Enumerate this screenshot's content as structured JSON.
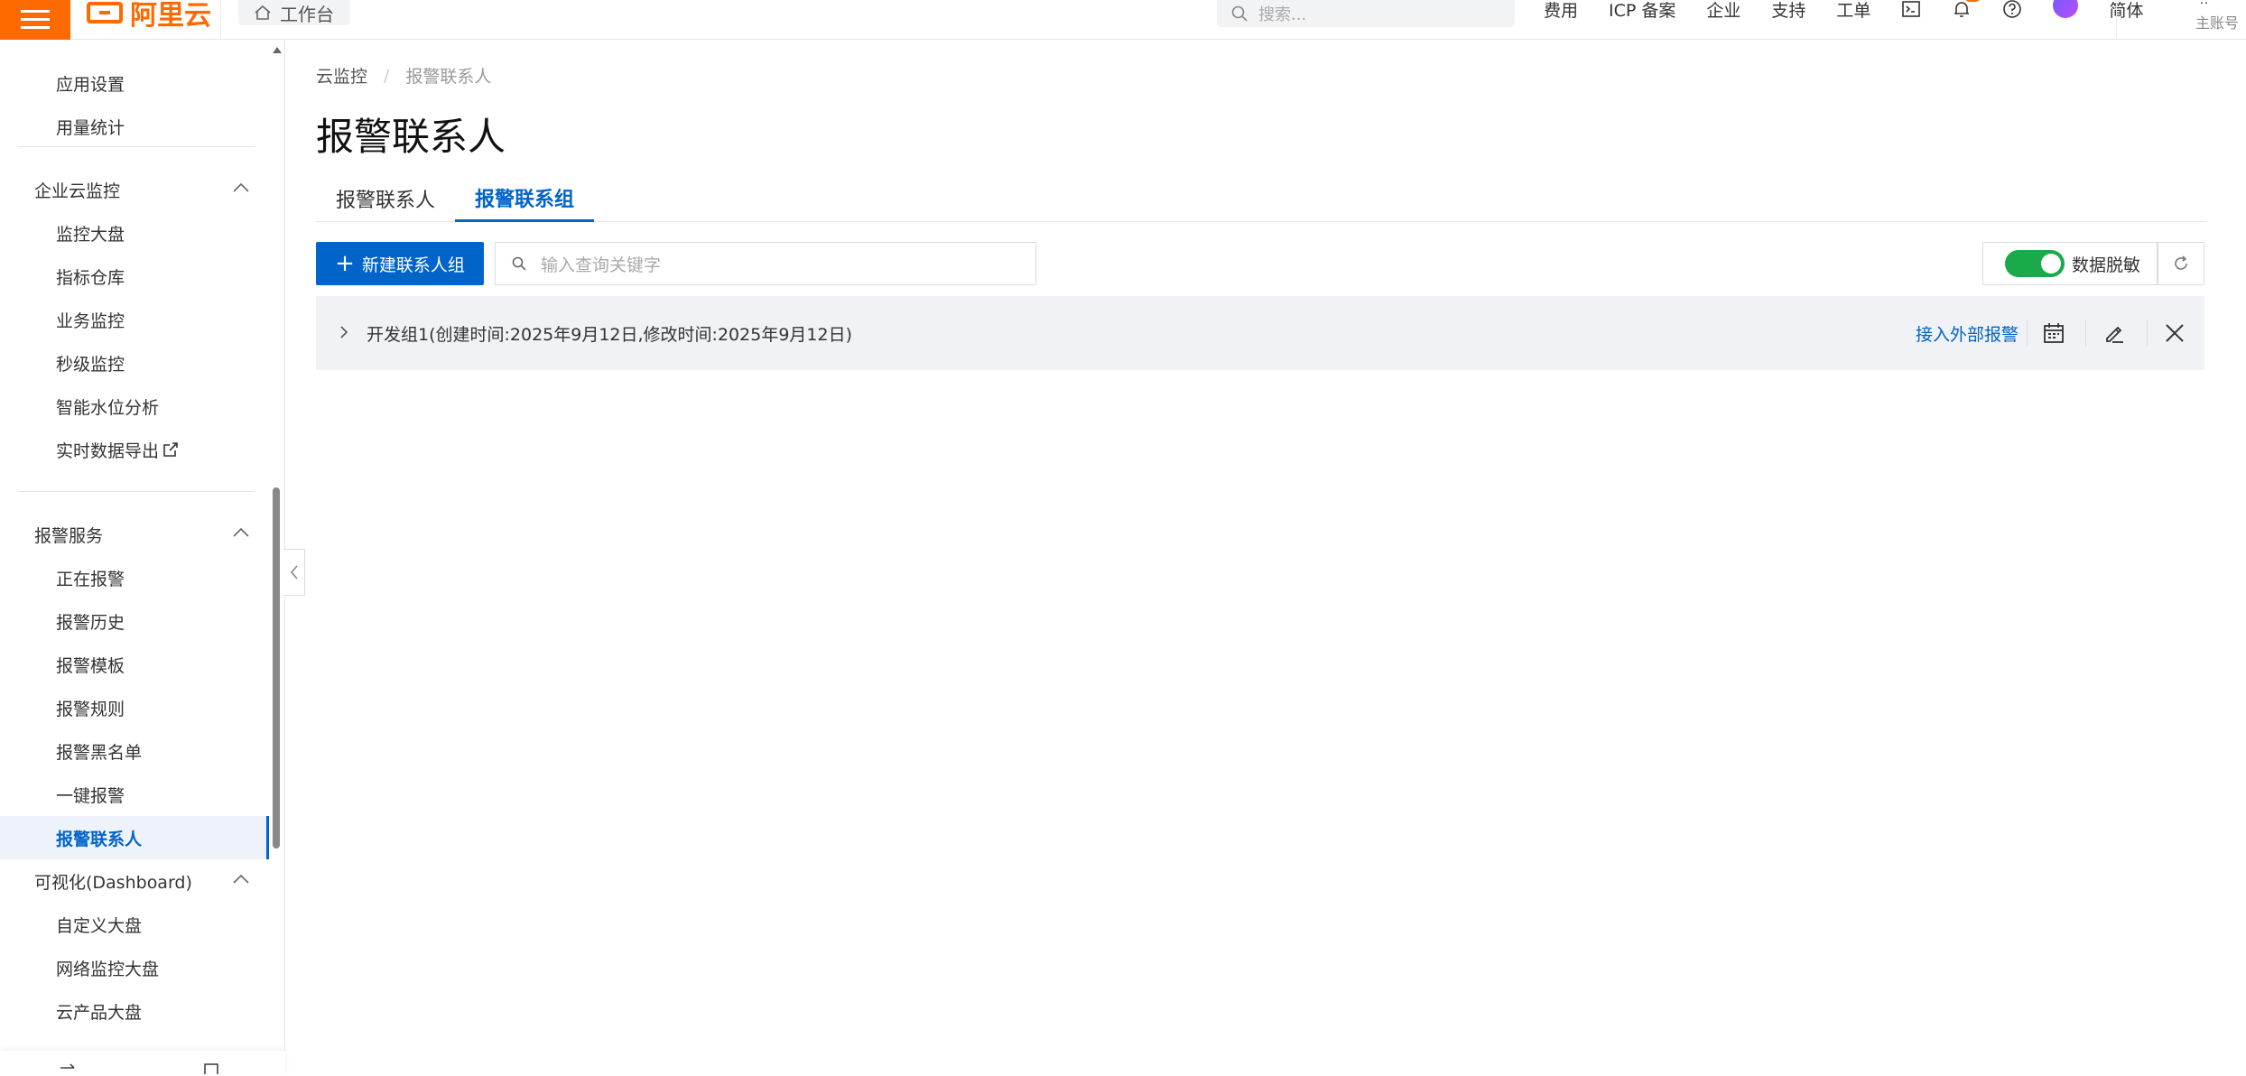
{
  "topbar": {
    "logo_text": "阿里云",
    "workbench_label": "工作台",
    "search_placeholder": "搜索...",
    "nav_items": [
      "费用",
      "ICP 备案",
      "企业",
      "支持",
      "工单"
    ],
    "lang_label": "简体",
    "account_name": "aliyun",
    "account_type": "主账号",
    "brand_color": "#ff6a00"
  },
  "sidebar": {
    "top_items": [
      "应用设置",
      "用量统计"
    ],
    "groups": [
      {
        "title": "企业云监控",
        "items": [
          "监控大盘",
          "指标仓库",
          "业务监控",
          "秒级监控",
          "智能水位分析",
          "实时数据导出"
        ]
      },
      {
        "title": "报警服务",
        "items": [
          "正在报警",
          "报警历史",
          "报警模板",
          "报警规则",
          "报警黑名单",
          "一键报警",
          "报警联系人"
        ]
      },
      {
        "title": "可视化(Dashboard)",
        "items": [
          "自定义大盘",
          "网络监控大盘",
          "云产品大盘"
        ]
      }
    ],
    "active_item": "报警联系人",
    "active_color": "#0064c8"
  },
  "main": {
    "breadcrumb": [
      "云监控",
      "报警联系人"
    ],
    "breadcrumb_sep": "/",
    "title": "报警联系人",
    "tabs": [
      {
        "label": "报警联系人",
        "active": false
      },
      {
        "label": "报警联系组",
        "active": true
      }
    ],
    "new_group_label": "新建联系人组",
    "query_placeholder": "输入查询关键字",
    "mask_label": "数据脱敏",
    "mask_enabled": true,
    "groups": [
      {
        "title": "开发组1(创建时间:2025年9月12日,修改时间:2025年9月12日)",
        "link_label": "接入外部报警"
      }
    ],
    "icons": {
      "calendar": "calendar-icon",
      "edit": "edit-icon",
      "delete": "close-icon",
      "refresh": "refresh-icon",
      "expand": "chevron-right-icon"
    }
  }
}
